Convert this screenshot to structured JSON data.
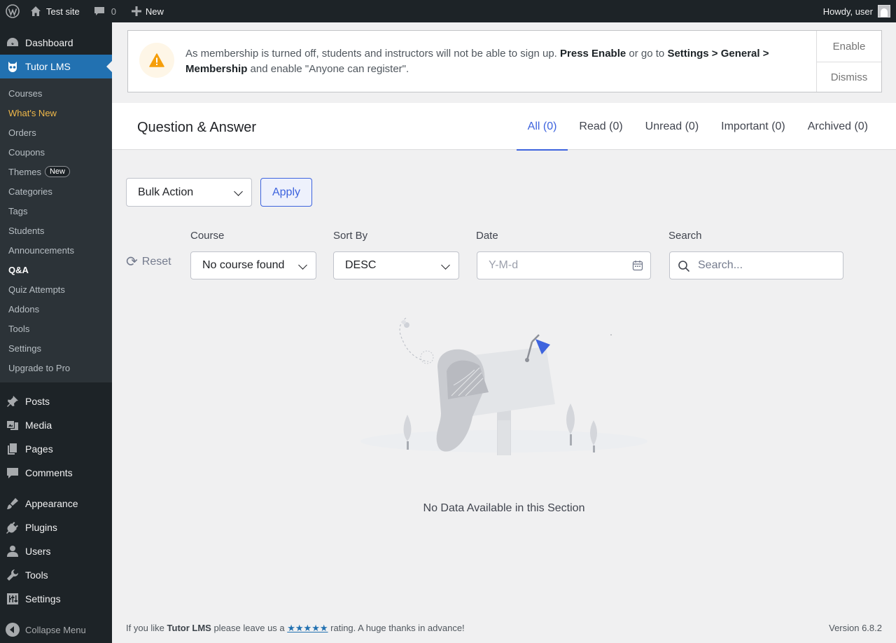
{
  "admin_bar": {
    "site_name": "Test site",
    "comments_count": "0",
    "new_label": "New",
    "greeting": "Howdy, user"
  },
  "sidebar": {
    "dashboard": "Dashboard",
    "tutor": "Tutor LMS",
    "submenu": {
      "courses": "Courses",
      "whats_new": "What's New",
      "orders": "Orders",
      "coupons": "Coupons",
      "themes": "Themes",
      "themes_badge": "New",
      "categories": "Categories",
      "tags": "Tags",
      "students": "Students",
      "announcements": "Announcements",
      "qa": "Q&A",
      "quiz_attempts": "Quiz Attempts",
      "addons": "Addons",
      "tools": "Tools",
      "settings": "Settings",
      "upgrade": "Upgrade to Pro"
    },
    "posts": "Posts",
    "media": "Media",
    "pages": "Pages",
    "comments": "Comments",
    "appearance": "Appearance",
    "plugins": "Plugins",
    "users": "Users",
    "tools": "Tools",
    "settings": "Settings",
    "collapse": "Collapse Menu"
  },
  "notice": {
    "part1": "As membership is turned off, students and instructors will not be able to sign up. ",
    "press_enable": "Press Enable",
    "part2": " or go to ",
    "settings_path": "Settings > General > Membership",
    "part3": " and enable \"Anyone can register\".",
    "enable": "Enable",
    "dismiss": "Dismiss"
  },
  "page": {
    "title": "Question & Answer",
    "tabs": {
      "all": "All (0)",
      "read": "Read (0)",
      "unread": "Unread (0)",
      "important": "Important (0)",
      "archived": "Archived (0)"
    }
  },
  "bulk": {
    "selected": "Bulk Action",
    "apply": "Apply"
  },
  "filters": {
    "reset": "Reset",
    "course_label": "Course",
    "course_value": "No course found",
    "sort_label": "Sort By",
    "sort_value": "DESC",
    "date_label": "Date",
    "date_placeholder": "Y-M-d",
    "search_label": "Search",
    "search_placeholder": "Search..."
  },
  "empty_state": {
    "message": "No Data Available in this Section"
  },
  "footer": {
    "left_1": "If you like ",
    "brand": "Tutor LMS",
    "left_2": " please leave us a ",
    "stars": "★★★★★",
    "left_3": " rating. A huge thanks in advance!",
    "version": "Version 6.8.2"
  },
  "colors": {
    "accent": "#3e64de",
    "wp_blue": "#2271b1",
    "admin_dark": "#1d2327",
    "warning": "#f59e0b"
  }
}
